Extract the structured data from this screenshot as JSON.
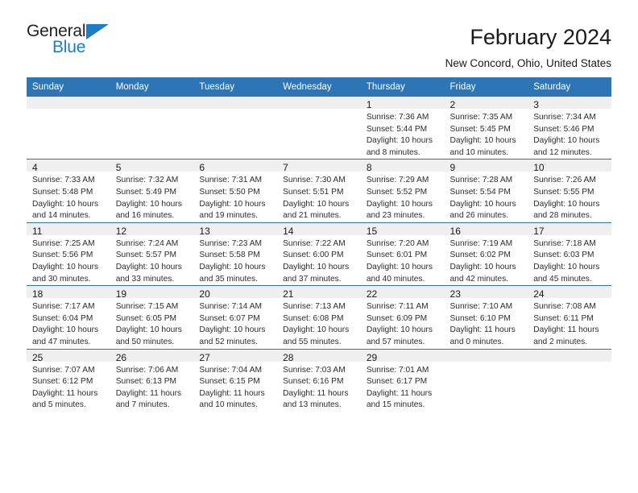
{
  "brand": {
    "name_top": "General",
    "name_bottom": "Blue",
    "color_dark": "#231f20",
    "color_blue": "#1b7dc4"
  },
  "header": {
    "month_title": "February 2024",
    "location": "New Concord, Ohio, United States",
    "header_bg": "#2e75b5",
    "daynum_bg": "#efefef"
  },
  "weekdays": [
    "Sunday",
    "Monday",
    "Tuesday",
    "Wednesday",
    "Thursday",
    "Friday",
    "Saturday"
  ],
  "weeks": [
    {
      "days": [
        {
          "num": "",
          "sunrise": "",
          "sunset": "",
          "daylight_1": "",
          "daylight_2": ""
        },
        {
          "num": "",
          "sunrise": "",
          "sunset": "",
          "daylight_1": "",
          "daylight_2": ""
        },
        {
          "num": "",
          "sunrise": "",
          "sunset": "",
          "daylight_1": "",
          "daylight_2": ""
        },
        {
          "num": "",
          "sunrise": "",
          "sunset": "",
          "daylight_1": "",
          "daylight_2": ""
        },
        {
          "num": "1",
          "sunrise": "Sunrise: 7:36 AM",
          "sunset": "Sunset: 5:44 PM",
          "daylight_1": "Daylight: 10 hours",
          "daylight_2": "and 8 minutes."
        },
        {
          "num": "2",
          "sunrise": "Sunrise: 7:35 AM",
          "sunset": "Sunset: 5:45 PM",
          "daylight_1": "Daylight: 10 hours",
          "daylight_2": "and 10 minutes."
        },
        {
          "num": "3",
          "sunrise": "Sunrise: 7:34 AM",
          "sunset": "Sunset: 5:46 PM",
          "daylight_1": "Daylight: 10 hours",
          "daylight_2": "and 12 minutes."
        }
      ]
    },
    {
      "days": [
        {
          "num": "4",
          "sunrise": "Sunrise: 7:33 AM",
          "sunset": "Sunset: 5:48 PM",
          "daylight_1": "Daylight: 10 hours",
          "daylight_2": "and 14 minutes."
        },
        {
          "num": "5",
          "sunrise": "Sunrise: 7:32 AM",
          "sunset": "Sunset: 5:49 PM",
          "daylight_1": "Daylight: 10 hours",
          "daylight_2": "and 16 minutes."
        },
        {
          "num": "6",
          "sunrise": "Sunrise: 7:31 AM",
          "sunset": "Sunset: 5:50 PM",
          "daylight_1": "Daylight: 10 hours",
          "daylight_2": "and 19 minutes."
        },
        {
          "num": "7",
          "sunrise": "Sunrise: 7:30 AM",
          "sunset": "Sunset: 5:51 PM",
          "daylight_1": "Daylight: 10 hours",
          "daylight_2": "and 21 minutes."
        },
        {
          "num": "8",
          "sunrise": "Sunrise: 7:29 AM",
          "sunset": "Sunset: 5:52 PM",
          "daylight_1": "Daylight: 10 hours",
          "daylight_2": "and 23 minutes."
        },
        {
          "num": "9",
          "sunrise": "Sunrise: 7:28 AM",
          "sunset": "Sunset: 5:54 PM",
          "daylight_1": "Daylight: 10 hours",
          "daylight_2": "and 26 minutes."
        },
        {
          "num": "10",
          "sunrise": "Sunrise: 7:26 AM",
          "sunset": "Sunset: 5:55 PM",
          "daylight_1": "Daylight: 10 hours",
          "daylight_2": "and 28 minutes."
        }
      ]
    },
    {
      "days": [
        {
          "num": "11",
          "sunrise": "Sunrise: 7:25 AM",
          "sunset": "Sunset: 5:56 PM",
          "daylight_1": "Daylight: 10 hours",
          "daylight_2": "and 30 minutes."
        },
        {
          "num": "12",
          "sunrise": "Sunrise: 7:24 AM",
          "sunset": "Sunset: 5:57 PM",
          "daylight_1": "Daylight: 10 hours",
          "daylight_2": "and 33 minutes."
        },
        {
          "num": "13",
          "sunrise": "Sunrise: 7:23 AM",
          "sunset": "Sunset: 5:58 PM",
          "daylight_1": "Daylight: 10 hours",
          "daylight_2": "and 35 minutes."
        },
        {
          "num": "14",
          "sunrise": "Sunrise: 7:22 AM",
          "sunset": "Sunset: 6:00 PM",
          "daylight_1": "Daylight: 10 hours",
          "daylight_2": "and 37 minutes."
        },
        {
          "num": "15",
          "sunrise": "Sunrise: 7:20 AM",
          "sunset": "Sunset: 6:01 PM",
          "daylight_1": "Daylight: 10 hours",
          "daylight_2": "and 40 minutes."
        },
        {
          "num": "16",
          "sunrise": "Sunrise: 7:19 AM",
          "sunset": "Sunset: 6:02 PM",
          "daylight_1": "Daylight: 10 hours",
          "daylight_2": "and 42 minutes."
        },
        {
          "num": "17",
          "sunrise": "Sunrise: 7:18 AM",
          "sunset": "Sunset: 6:03 PM",
          "daylight_1": "Daylight: 10 hours",
          "daylight_2": "and 45 minutes."
        }
      ]
    },
    {
      "days": [
        {
          "num": "18",
          "sunrise": "Sunrise: 7:17 AM",
          "sunset": "Sunset: 6:04 PM",
          "daylight_1": "Daylight: 10 hours",
          "daylight_2": "and 47 minutes."
        },
        {
          "num": "19",
          "sunrise": "Sunrise: 7:15 AM",
          "sunset": "Sunset: 6:05 PM",
          "daylight_1": "Daylight: 10 hours",
          "daylight_2": "and 50 minutes."
        },
        {
          "num": "20",
          "sunrise": "Sunrise: 7:14 AM",
          "sunset": "Sunset: 6:07 PM",
          "daylight_1": "Daylight: 10 hours",
          "daylight_2": "and 52 minutes."
        },
        {
          "num": "21",
          "sunrise": "Sunrise: 7:13 AM",
          "sunset": "Sunset: 6:08 PM",
          "daylight_1": "Daylight: 10 hours",
          "daylight_2": "and 55 minutes."
        },
        {
          "num": "22",
          "sunrise": "Sunrise: 7:11 AM",
          "sunset": "Sunset: 6:09 PM",
          "daylight_1": "Daylight: 10 hours",
          "daylight_2": "and 57 minutes."
        },
        {
          "num": "23",
          "sunrise": "Sunrise: 7:10 AM",
          "sunset": "Sunset: 6:10 PM",
          "daylight_1": "Daylight: 11 hours",
          "daylight_2": "and 0 minutes."
        },
        {
          "num": "24",
          "sunrise": "Sunrise: 7:08 AM",
          "sunset": "Sunset: 6:11 PM",
          "daylight_1": "Daylight: 11 hours",
          "daylight_2": "and 2 minutes."
        }
      ]
    },
    {
      "days": [
        {
          "num": "25",
          "sunrise": "Sunrise: 7:07 AM",
          "sunset": "Sunset: 6:12 PM",
          "daylight_1": "Daylight: 11 hours",
          "daylight_2": "and 5 minutes."
        },
        {
          "num": "26",
          "sunrise": "Sunrise: 7:06 AM",
          "sunset": "Sunset: 6:13 PM",
          "daylight_1": "Daylight: 11 hours",
          "daylight_2": "and 7 minutes."
        },
        {
          "num": "27",
          "sunrise": "Sunrise: 7:04 AM",
          "sunset": "Sunset: 6:15 PM",
          "daylight_1": "Daylight: 11 hours",
          "daylight_2": "and 10 minutes."
        },
        {
          "num": "28",
          "sunrise": "Sunrise: 7:03 AM",
          "sunset": "Sunset: 6:16 PM",
          "daylight_1": "Daylight: 11 hours",
          "daylight_2": "and 13 minutes."
        },
        {
          "num": "29",
          "sunrise": "Sunrise: 7:01 AM",
          "sunset": "Sunset: 6:17 PM",
          "daylight_1": "Daylight: 11 hours",
          "daylight_2": "and 15 minutes."
        },
        {
          "num": "",
          "sunrise": "",
          "sunset": "",
          "daylight_1": "",
          "daylight_2": ""
        },
        {
          "num": "",
          "sunrise": "",
          "sunset": "",
          "daylight_1": "",
          "daylight_2": ""
        }
      ]
    }
  ]
}
